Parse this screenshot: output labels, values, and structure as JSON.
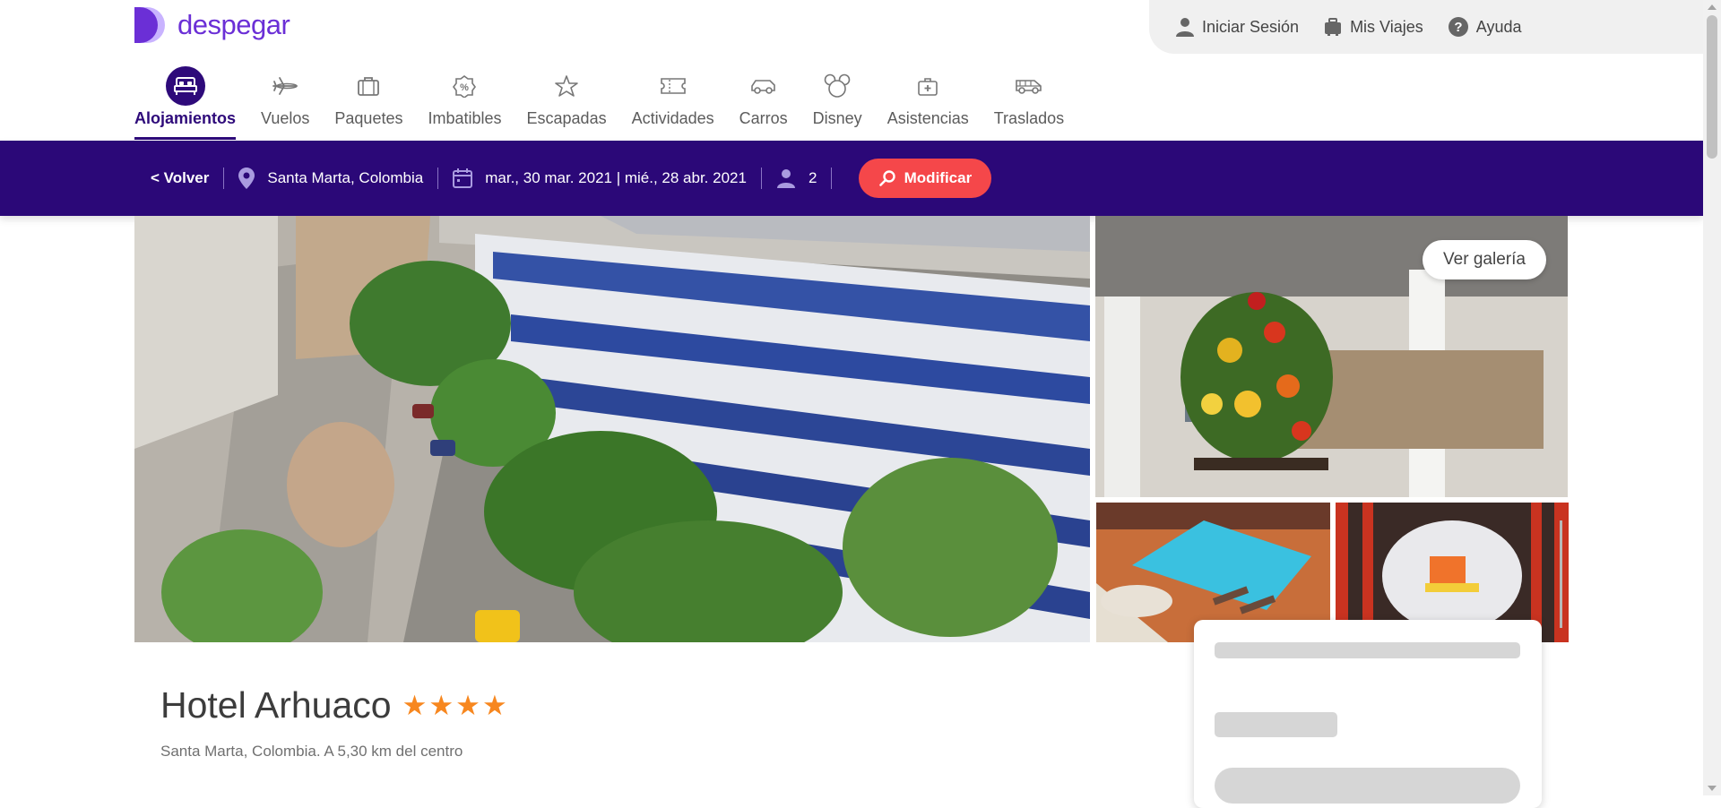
{
  "brand": {
    "name": "despegar",
    "color": "#6b2fd6"
  },
  "user_menu": [
    {
      "icon": "user-icon",
      "label": "Iniciar Sesión"
    },
    {
      "icon": "suitcase-icon",
      "label": "Mis Viajes"
    },
    {
      "icon": "help-icon",
      "label": "Ayuda"
    }
  ],
  "nav": [
    {
      "icon": "bed-icon",
      "label": "Alojamientos",
      "active": true
    },
    {
      "icon": "plane-icon",
      "label": "Vuelos"
    },
    {
      "icon": "bag-icon",
      "label": "Paquetes"
    },
    {
      "icon": "badge-icon",
      "label": "Imbatibles"
    },
    {
      "icon": "star-plane-icon",
      "label": "Escapadas"
    },
    {
      "icon": "ticket-icon",
      "label": "Actividades"
    },
    {
      "icon": "car-icon",
      "label": "Carros"
    },
    {
      "icon": "mouse-ears-icon",
      "label": "Disney"
    },
    {
      "icon": "medkit-icon",
      "label": "Asistencias"
    },
    {
      "icon": "van-icon",
      "label": "Traslados"
    }
  ],
  "search": {
    "back_label": "< Volver",
    "destination": "Santa Marta, Colombia",
    "dates": "mar., 30 mar. 2021 | mié., 28 abr. 2021",
    "guests": "2",
    "modify_label": "Modificar",
    "bar_color": "#2b0878",
    "button_color": "#f5474a"
  },
  "gallery": {
    "button_label": "Ver galería"
  },
  "hotel": {
    "name": "Hotel Arhuaco",
    "stars": 4,
    "location": "Santa Marta, Colombia. A 5,30 km del centro",
    "star_color": "#f7871f"
  }
}
